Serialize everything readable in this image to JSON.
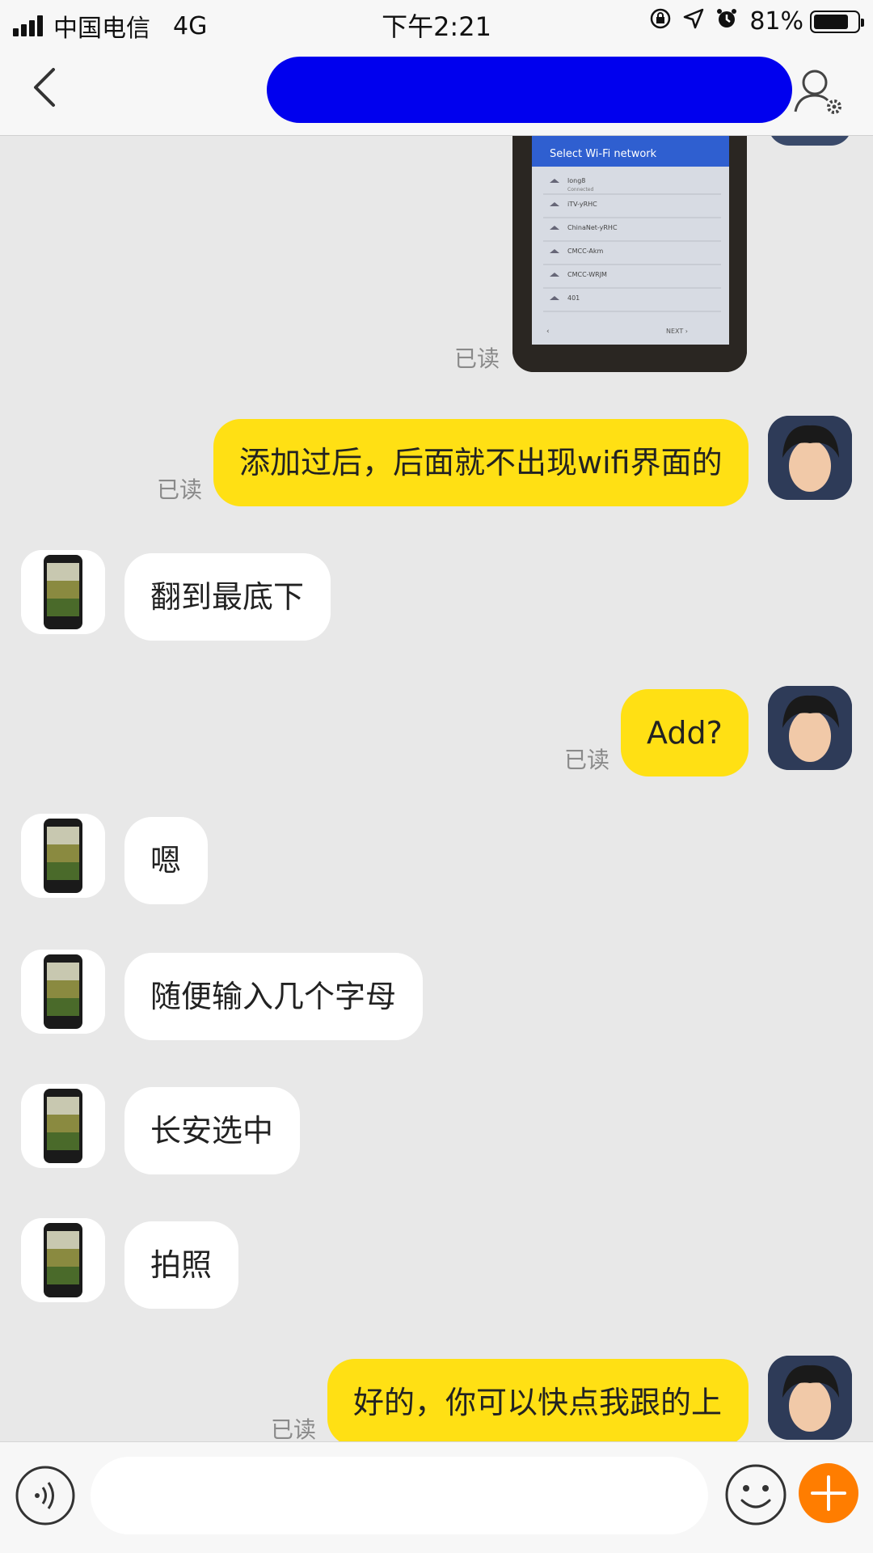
{
  "status_bar": {
    "carrier": "中国电信",
    "network": "4G",
    "time": "下午2:21",
    "battery_percent": "81%",
    "battery_level": 0.81
  },
  "nav": {
    "title": "",
    "back_icon": "chevron-left-icon",
    "profile_icon": "user-settings-icon"
  },
  "image_message": {
    "header": "Select Wi-Fi network",
    "networks": [
      "long8",
      "iTV-yRHC",
      "ChinaNet-yRHC",
      "CMCC-Akm",
      "CMCC-WRJM",
      "401"
    ],
    "connected_label": "Connected",
    "next_label": "NEXT",
    "read_label": "已读"
  },
  "messages": [
    {
      "side": "out",
      "text": "添加过后，后面就不出现wifi界面的",
      "read": "已读"
    },
    {
      "side": "in",
      "text": "翻到最底下"
    },
    {
      "side": "out",
      "text": "Add?",
      "read": "已读"
    },
    {
      "side": "in",
      "text": "嗯"
    },
    {
      "side": "in",
      "text": "随便输入几个字母"
    },
    {
      "side": "in",
      "text": "长安选中"
    },
    {
      "side": "in",
      "text": "拍照"
    },
    {
      "side": "out",
      "text": "好的，你可以快点我跟的上",
      "read": "已读"
    }
  ],
  "input_bar": {
    "placeholder": "",
    "voice_icon": "voice-icon",
    "emoji_icon": "emoji-icon",
    "plus_icon": "plus-icon"
  },
  "colors": {
    "out_bubble": "#ffe014",
    "in_bubble": "#ffffff",
    "background": "#e8e8e8",
    "plus_button": "#ff7d00"
  }
}
